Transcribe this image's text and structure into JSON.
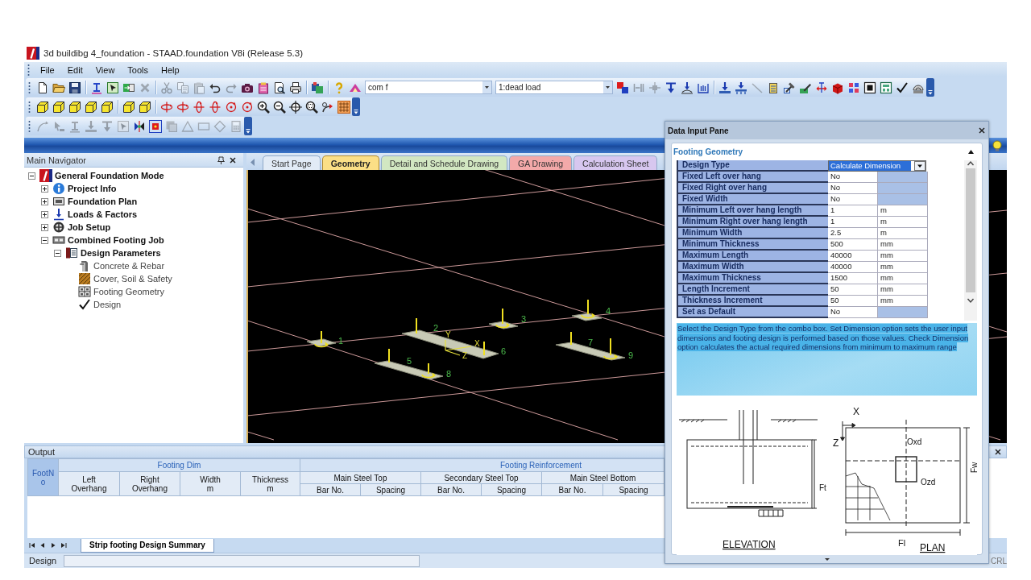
{
  "window": {
    "title": "3d buildibg 4_foundation - STAAD.foundation V8i (Release 5.3)"
  },
  "menu": [
    "File",
    "Edit",
    "View",
    "Tools",
    "Help"
  ],
  "toolbars": [
    {
      "items": [
        {
          "kind": "page",
          "disabled": false
        },
        {
          "kind": "folder",
          "disabled": false
        },
        {
          "kind": "disk",
          "disabled": false
        },
        {
          "kind": "separator"
        },
        {
          "kind": "i-beam",
          "disabled": false
        },
        {
          "kind": "frame",
          "disabled": false
        },
        {
          "kind": "table",
          "disabled": false
        },
        {
          "kind": "cross",
          "disabled": true
        },
        {
          "kind": "separator"
        },
        {
          "kind": "scissors",
          "disabled": true
        },
        {
          "kind": "copy",
          "disabled": true
        },
        {
          "kind": "clipboard",
          "disabled": true
        },
        {
          "kind": "undo",
          "disabled": false
        },
        {
          "kind": "redo",
          "disabled": true
        },
        {
          "kind": "camera",
          "disabled": false
        },
        {
          "kind": "report",
          "disabled": false
        },
        {
          "kind": "preview",
          "disabled": false
        },
        {
          "kind": "printer",
          "disabled": false
        },
        {
          "kind": "separator"
        },
        {
          "kind": "model",
          "disabled": false
        },
        {
          "kind": "separator"
        },
        {
          "kind": "help",
          "disabled": false
        },
        {
          "kind": "roof",
          "disabled": false
        },
        {
          "kind": "combo",
          "value": "com f"
        },
        {
          "kind": "combo",
          "value": "1:dead load"
        },
        {
          "kind": "squares",
          "disabled": false
        },
        {
          "kind": "bars",
          "disabled": true
        },
        {
          "kind": "node",
          "disabled": true
        },
        {
          "kind": "down-arrow",
          "disabled": false
        },
        {
          "kind": "support",
          "disabled": false
        },
        {
          "kind": "bracket",
          "disabled": false
        },
        {
          "kind": "separator"
        },
        {
          "kind": "footing",
          "disabled": false
        },
        {
          "kind": "pile",
          "disabled": false
        },
        {
          "kind": "line",
          "disabled": true
        },
        {
          "kind": "building",
          "disabled": false
        },
        {
          "kind": "hammer",
          "disabled": false
        },
        {
          "kind": "pen",
          "disabled": false
        },
        {
          "kind": "dimension",
          "disabled": false
        },
        {
          "kind": "solid-cube",
          "disabled": false
        },
        {
          "kind": "dots",
          "disabled": false
        },
        {
          "kind": "stop",
          "disabled": false
        },
        {
          "kind": "panel",
          "disabled": false
        },
        {
          "kind": "check",
          "disabled": false
        },
        {
          "kind": "dome",
          "disabled": false
        }
      ]
    },
    {
      "items": [
        {
          "kind": "cube",
          "disabled": false
        },
        {
          "kind": "cube",
          "disabled": false
        },
        {
          "kind": "cube",
          "disabled": false
        },
        {
          "kind": "cube",
          "disabled": false
        },
        {
          "kind": "cube",
          "disabled": false
        },
        {
          "kind": "separator"
        },
        {
          "kind": "cube",
          "disabled": false
        },
        {
          "kind": "cube",
          "disabled": false
        },
        {
          "kind": "separator"
        },
        {
          "kind": "rotate",
          "disabled": false
        },
        {
          "kind": "rotate",
          "disabled": false
        },
        {
          "kind": "spin",
          "disabled": false
        },
        {
          "kind": "spin",
          "disabled": false
        },
        {
          "kind": "turn",
          "disabled": false
        },
        {
          "kind": "turn",
          "disabled": false
        },
        {
          "kind": "zoom-in",
          "disabled": false
        },
        {
          "kind": "zoom-out",
          "disabled": false
        },
        {
          "kind": "zoom-all",
          "disabled": false
        },
        {
          "kind": "zoom-window",
          "disabled": false
        },
        {
          "kind": "pan",
          "disabled": false
        },
        {
          "kind": "grid",
          "disabled": false
        }
      ]
    },
    {
      "items": [
        {
          "kind": "curve",
          "disabled": true
        },
        {
          "kind": "pointer",
          "disabled": true
        },
        {
          "kind": "i-beam",
          "disabled": true
        },
        {
          "kind": "footing",
          "disabled": true
        },
        {
          "kind": "down-arrow",
          "disabled": true
        },
        {
          "kind": "frame",
          "disabled": true
        },
        {
          "kind": "mirror",
          "disabled": false
        },
        {
          "kind": "target",
          "disabled": false
        },
        {
          "kind": "block",
          "disabled": true
        },
        {
          "kind": "triangle",
          "disabled": true
        },
        {
          "kind": "rectangle",
          "disabled": true
        },
        {
          "kind": "diamond",
          "disabled": true
        },
        {
          "kind": "calculator",
          "disabled": true
        }
      ]
    }
  ],
  "navigator": {
    "title": "Main Navigator",
    "tree": [
      {
        "label": "General Foundation Mode",
        "kind": "mode",
        "expanded": true,
        "children": [
          {
            "label": "Project Info",
            "kind": "info",
            "expanded": false
          },
          {
            "label": "Foundation Plan",
            "kind": "plan",
            "expanded": false
          },
          {
            "label": "Loads & Factors",
            "kind": "load",
            "expanded": false
          },
          {
            "label": "Job Setup",
            "kind": "setup",
            "expanded": false
          },
          {
            "label": "Combined Footing Job",
            "kind": "job",
            "expanded": true,
            "children": [
              {
                "label": "Design Parameters",
                "kind": "parameters",
                "expanded": true,
                "children": [
                  {
                    "label": "Concrete & Rebar",
                    "kind": "rebar"
                  },
                  {
                    "label": "Cover, Soil & Safety",
                    "kind": "soil"
                  },
                  {
                    "label": "Footing Geometry",
                    "kind": "geometry"
                  },
                  {
                    "label": "Design",
                    "kind": "design"
                  }
                ]
              }
            ]
          }
        ]
      }
    ]
  },
  "document_tabs": [
    {
      "label": "Start Page",
      "selected": false,
      "color": "#e2ebf6"
    },
    {
      "label": "Geometry",
      "selected": true,
      "color": "#fbdf86"
    },
    {
      "label": "Detail and Schedule Drawing",
      "selected": false,
      "color": "#d2e7c2"
    },
    {
      "label": "GA Drawing",
      "selected": false,
      "color": "#f3a9a9"
    },
    {
      "label": "Calculation Sheet",
      "selected": false,
      "color": "#d7c7ef"
    }
  ],
  "viewport": {
    "nodes": [
      {
        "label": "1",
        "moment": true
      },
      {
        "label": "2",
        "moment": false
      },
      {
        "label": "3",
        "moment": true
      },
      {
        "label": "4",
        "moment": true
      },
      {
        "label": "5",
        "moment": false
      },
      {
        "label": "6",
        "moment": false
      },
      {
        "label": "7",
        "moment": false
      },
      {
        "label": "8",
        "moment": true
      },
      {
        "label": "9",
        "moment": true
      }
    ],
    "axis_labels": [
      "Y",
      "X",
      "Z"
    ]
  },
  "output": {
    "title": "Output",
    "table": {
      "key_column": "FootNo",
      "groups": [
        {
          "title": "Footing Dim",
          "columns": [
            {
              "lines": [
                "Left",
                "Overhang"
              ]
            },
            {
              "lines": [
                "Right",
                "Overhang"
              ]
            },
            {
              "lines": [
                "Width",
                "m"
              ]
            },
            {
              "lines": [
                "Thickness",
                "m"
              ]
            }
          ]
        },
        {
          "title": "Footing Reinforcement",
          "subgroups": [
            {
              "title": "Main Steel Top",
              "columns": [
                "Bar No.",
                "Spacing"
              ]
            },
            {
              "title": "Secondary Steel Top",
              "columns": [
                "Bar No.",
                "Spacing"
              ]
            },
            {
              "title": "Main Steel Bottom",
              "columns": [
                "Bar No.",
                "Spacing"
              ]
            }
          ]
        }
      ]
    },
    "sheet_tabs": [
      {
        "label": "Strip footing Design Summary",
        "selected": true
      }
    ]
  },
  "status_bar": {
    "text": "Design",
    "indicator": "CRL"
  },
  "data_input_pane": {
    "title": "Data Input Pane",
    "section": {
      "title": "Footing Geometry",
      "expanded": true
    },
    "rows": [
      {
        "label": "Design Type",
        "kind": "dropdown",
        "value": "Calculate Dimension"
      },
      {
        "label": "Fixed Left over hang",
        "kind": "field",
        "value": "No"
      },
      {
        "label": "Fixed Right over hang",
        "kind": "field",
        "value": "No"
      },
      {
        "label": "Fixed Width",
        "kind": "field",
        "value": "No"
      },
      {
        "label": "Minimum Left over hang length",
        "kind": "field",
        "value": "1",
        "unit": "m"
      },
      {
        "label": "Minimum Right over hang length",
        "kind": "field",
        "value": "1",
        "unit": "m"
      },
      {
        "label": "Minimum Width",
        "kind": "field",
        "value": "2.5",
        "unit": "m"
      },
      {
        "label": "Minimum Thickness",
        "kind": "field",
        "value": "500",
        "unit": "mm"
      },
      {
        "label": "Maximum Length",
        "kind": "field",
        "value": "40000",
        "unit": "mm"
      },
      {
        "label": "Maximum Width",
        "kind": "field",
        "value": "40000",
        "unit": "mm"
      },
      {
        "label": "Maximum Thickness",
        "kind": "field",
        "value": "1500",
        "unit": "mm"
      },
      {
        "label": "Length Increment",
        "kind": "field",
        "value": "50",
        "unit": "mm"
      },
      {
        "label": "Thickness Increment",
        "kind": "field",
        "value": "50",
        "unit": "mm"
      },
      {
        "label": "Set as Default",
        "kind": "field",
        "value": "No"
      }
    ],
    "description": "Select the Design Type from the combo box. Set Dimension option sets the user input dimensions and footing design is performed based on those values. Check Dimension option calculates the actual required dimensions from minimum to maximum range",
    "diagram": {
      "labels": [
        "X",
        "Z",
        "Oxd",
        "Ozd",
        "Fw",
        "Ft",
        "ELEVATION",
        "Fl",
        "PLAN"
      ]
    }
  }
}
